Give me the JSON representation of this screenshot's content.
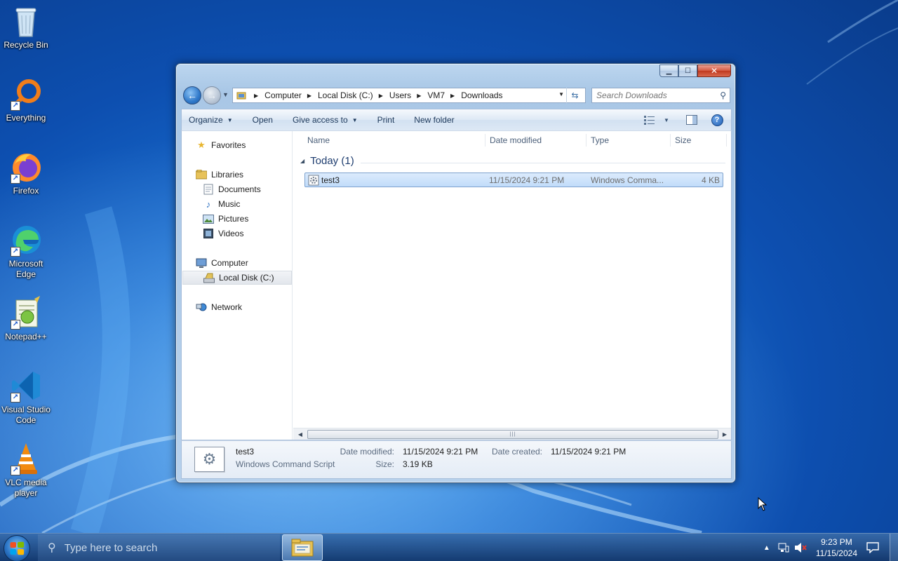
{
  "desktop": {
    "icons": [
      {
        "label": "Recycle Bin"
      },
      {
        "label": "Everything"
      },
      {
        "label": "Firefox"
      },
      {
        "label": "Microsoft Edge"
      },
      {
        "label": "Notepad++"
      },
      {
        "label": "Visual Studio Code"
      },
      {
        "label": "VLC media player"
      }
    ]
  },
  "window": {
    "caption_buttons": {
      "minimize": "▁",
      "maximize": "☐",
      "close": "✕"
    },
    "address": {
      "segments": [
        "Computer",
        "Local Disk (C:)",
        "Users",
        "VM7",
        "Downloads"
      ]
    },
    "search": {
      "placeholder": "Search Downloads"
    },
    "toolbar": {
      "organize": "Organize",
      "open": "Open",
      "give_access": "Give access to",
      "print": "Print",
      "new_folder": "New folder"
    },
    "nav_pane": {
      "favorites": "Favorites",
      "libraries": "Libraries",
      "documents": "Documents",
      "music": "Music",
      "pictures": "Pictures",
      "videos": "Videos",
      "computer": "Computer",
      "local_disk": "Local Disk (C:)",
      "network": "Network"
    },
    "columns": {
      "name": "Name",
      "date_modified": "Date modified",
      "type": "Type",
      "size": "Size"
    },
    "group": {
      "label": "Today (1)"
    },
    "files": [
      {
        "name": "test3",
        "date_modified": "11/15/2024 9:21 PM",
        "type": "Windows Comma...",
        "size": "4 KB"
      }
    ],
    "details": {
      "name": "test3",
      "type": "Windows Command Script",
      "date_modified_label": "Date modified:",
      "date_modified": "11/15/2024 9:21 PM",
      "date_created_label": "Date created:",
      "date_created": "11/15/2024 9:21 PM",
      "size_label": "Size:",
      "size": "3.19 KB"
    }
  },
  "taskbar": {
    "search_placeholder": "Type here to search",
    "time": "9:23 PM",
    "date": "11/15/2024"
  },
  "colors": {
    "selection": "#c1dcfa",
    "window_frame": "#a9c7e6",
    "taskbar": "#1d4a86"
  }
}
